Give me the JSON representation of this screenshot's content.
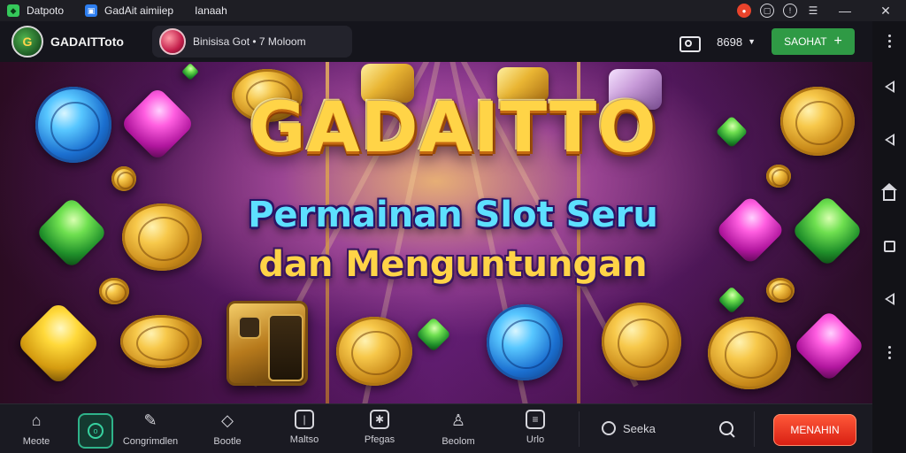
{
  "titlebar": {
    "tabs": [
      {
        "label": "Datpoto",
        "icon": "green-app-icon",
        "color": "#35c85a"
      },
      {
        "label": "GadAit aimiiep",
        "icon": "blue-app-icon",
        "color": "#2d7ef0"
      },
      {
        "label": "Ianaah"
      }
    ],
    "controls": [
      "record-icon",
      "settings-circle-icon",
      "info-circle-icon",
      "sliders-icon",
      "minimize-icon",
      "close-icon"
    ]
  },
  "header": {
    "app_name": "GADAITToto",
    "promo_text": "Binisisa Got • 7 Moloom",
    "balance": "8698",
    "register_label": "SAOHAT",
    "register_plus": "+",
    "accent": "#2f9a45"
  },
  "banner": {
    "brand": "GADAITTO",
    "tagline_line1": "Permainan Slot Seru",
    "tagline_line2": "dan Menguntungan"
  },
  "bottomnav": {
    "items": [
      {
        "label": "Meote",
        "icon": "home-icon"
      },
      {
        "label": "Congrimdlen",
        "icon": "feather-icon"
      },
      {
        "label": "Bootle",
        "icon": "tag-icon"
      },
      {
        "label": "Maltso",
        "icon": "card-icon"
      },
      {
        "label": "Pfegas",
        "icon": "gift-icon"
      },
      {
        "label": "Beolom",
        "icon": "person-icon"
      },
      {
        "label": "Urlo",
        "icon": "list-icon"
      }
    ],
    "search_label": "Seeka",
    "cta_label": "MENAHIN",
    "cta_color": "#e03018"
  },
  "sidebar": {
    "icons": [
      "dots-icon",
      "back-icon",
      "back-icon",
      "home-icon",
      "recent-icon",
      "back-icon",
      "more-icon"
    ]
  }
}
